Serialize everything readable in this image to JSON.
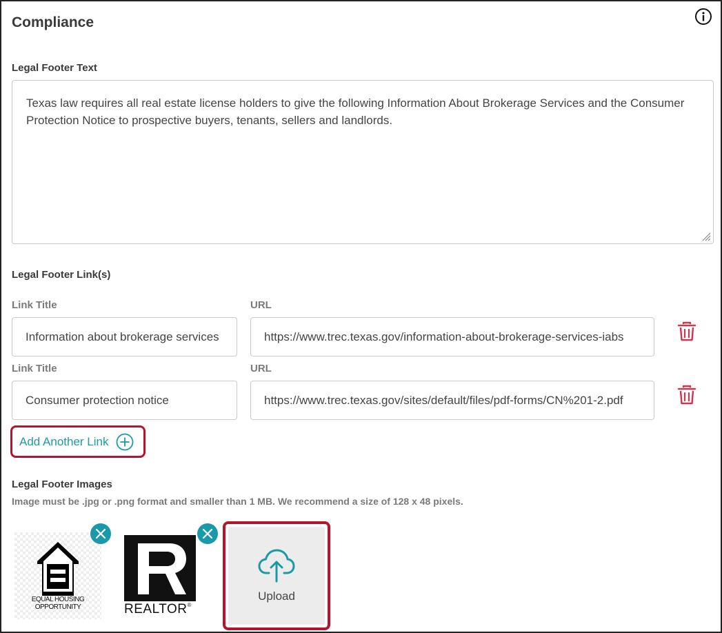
{
  "section": {
    "title": "Compliance",
    "info_icon": "info-circle-icon"
  },
  "legal_footer_text": {
    "label": "Legal Footer Text",
    "value": "Texas law requires all real estate license holders to give the following Information About Brokerage Services and the Consumer Protection Notice to prospective buyers, tenants, sellers and landlords."
  },
  "legal_footer_links": {
    "label": "Legal Footer Link(s)",
    "links": [
      {
        "title_label": "Link Title",
        "title_value": "Information about brokerage services",
        "url_label": "URL",
        "url_value": "https://www.trec.texas.gov/information-about-brokerage-services-iabs"
      },
      {
        "title_label": "Link Title",
        "title_value": "Consumer protection notice",
        "url_label": "URL",
        "url_value": "https://www.trec.texas.gov/sites/default/files/pdf-forms/CN%201-2.pdf"
      }
    ],
    "add_label": "Add Another Link"
  },
  "legal_footer_images": {
    "label": "Legal Footer Images",
    "help": "Image must be .jpg or .png format and smaller than 1 MB. We recommend a size of 128 x 48 pixels.",
    "images": [
      {
        "name": "equal-housing-opportunity-logo",
        "caption_line1": "EQUAL HOUSING",
        "caption_line2": "OPPORTUNITY"
      },
      {
        "name": "realtor-logo",
        "caption": "REALTOR"
      }
    ],
    "upload_label": "Upload"
  },
  "colors": {
    "accent": "#1a9aa8",
    "danger": "#d0344e",
    "highlight": "#b5152b"
  }
}
